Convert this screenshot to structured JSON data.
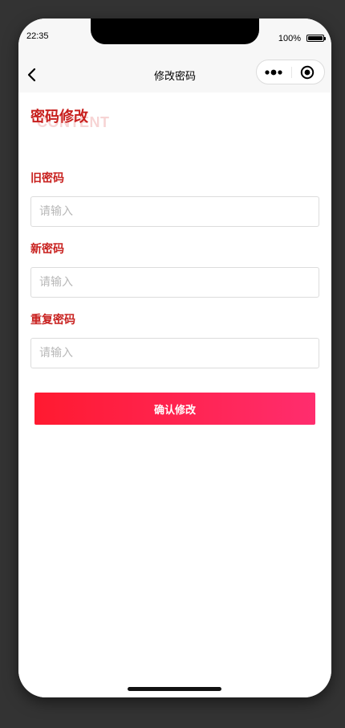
{
  "status_bar": {
    "time": "22:35",
    "battery_percent": "100%"
  },
  "nav": {
    "title": "修改密码",
    "back_icon": "chevron-left-icon",
    "more_icon": "more-dots-icon",
    "close_icon": "target-circle-icon"
  },
  "page": {
    "title": "密码修改",
    "title_watermark": "CONTENT"
  },
  "form": {
    "old_password_label": "旧密码",
    "old_password_placeholder": "请输入",
    "old_password_value": "",
    "new_password_label": "新密码",
    "new_password_placeholder": "请输入",
    "new_password_value": "",
    "repeat_password_label": "重复密码",
    "repeat_password_placeholder": "请输入",
    "repeat_password_value": "",
    "submit_label": "确认修改"
  },
  "colors": {
    "accent_text": "#c8201e",
    "button_gradient_start": "#ff1a30",
    "button_gradient_end": "#ff2d6e",
    "nav_background": "#f7f7f7",
    "backdrop": "#333333"
  }
}
